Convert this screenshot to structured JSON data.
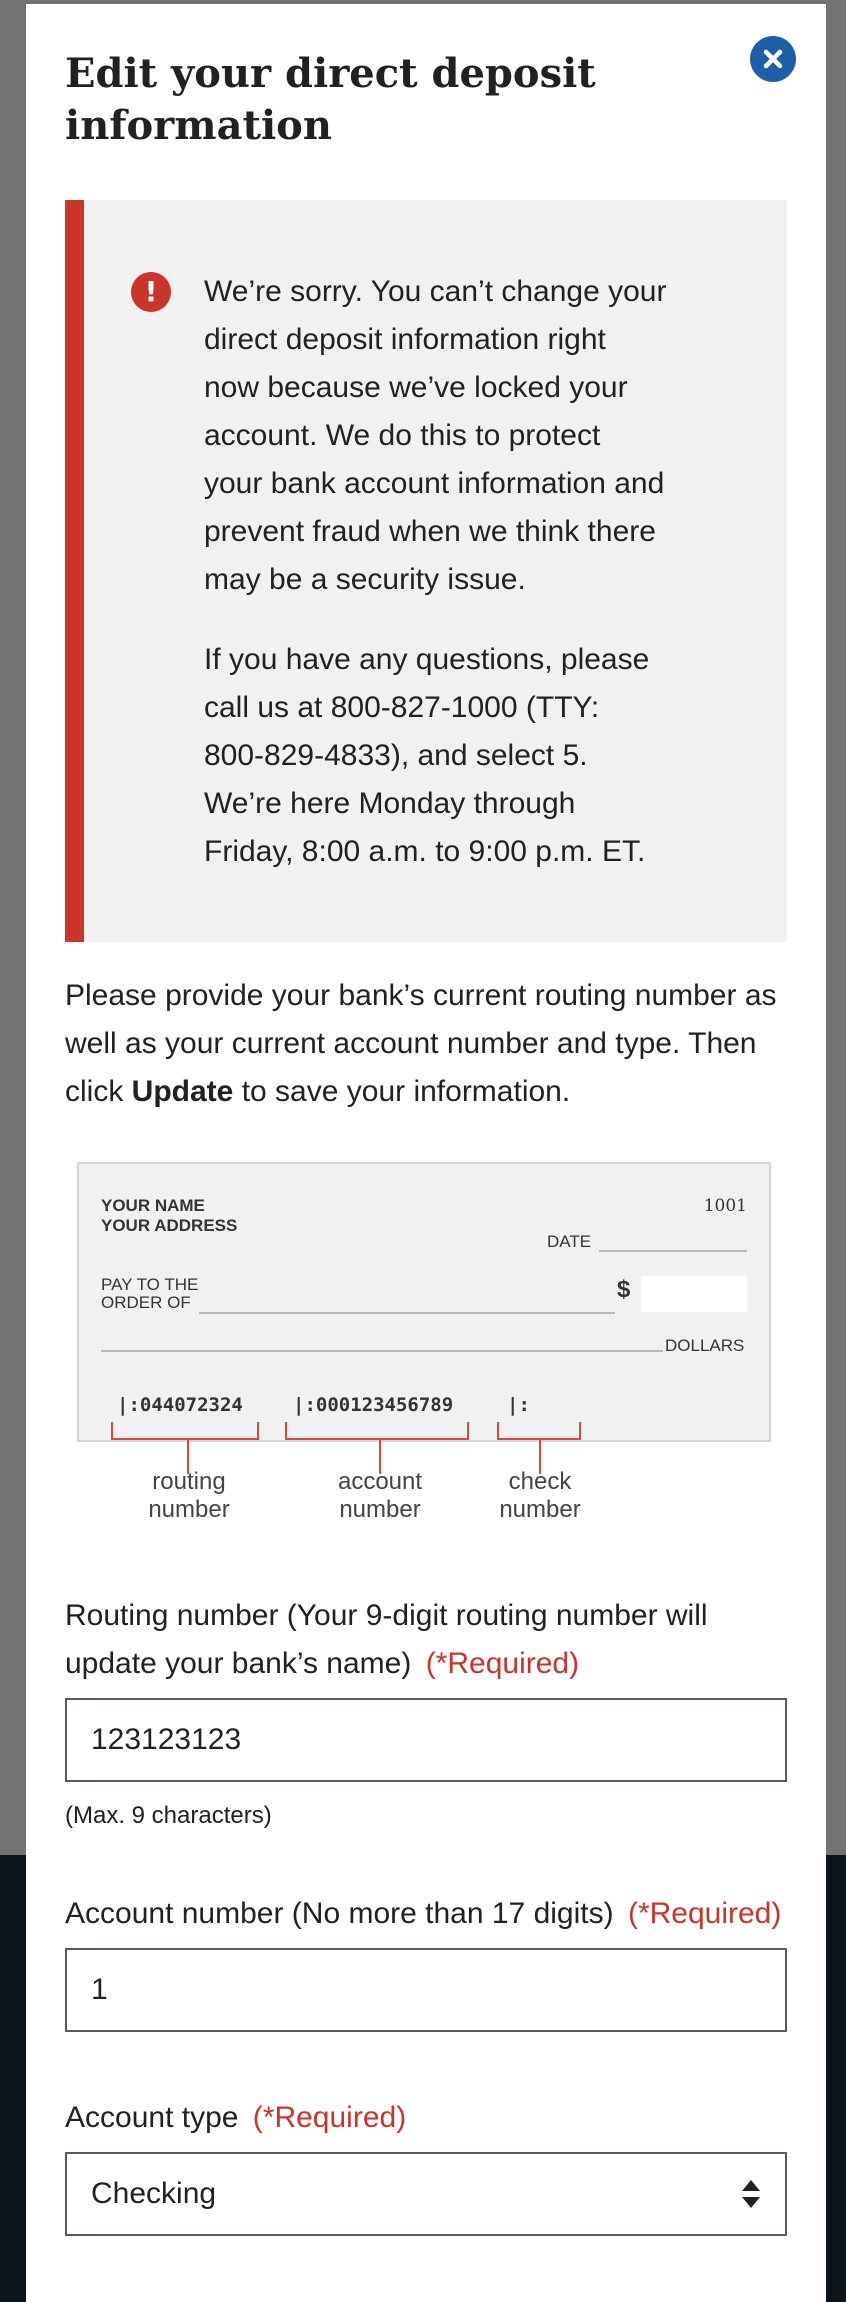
{
  "modal": {
    "title": "Edit your direct deposit information",
    "close_icon": "close-icon"
  },
  "alert": {
    "icon": "error-icon",
    "paragraph1": "We’re sorry. You can’t change your direct deposit information right now because we’ve locked your account. We do this to protect your bank account information and prevent fraud when we think there may be a security issue.",
    "paragraph2": "If you have any questions, please call us at 800-827-1000 (TTY: 800-829-4833), and select 5. We’re here Monday through Friday, 8:00 a.m. to 9:00 p.m. ET.",
    "accent_color": "#c9342b"
  },
  "intro": {
    "before": "Please provide your bank’s current routing number as well as your current account number and type. Then click ",
    "bold": "Update",
    "after": " to save your information."
  },
  "check": {
    "name": "YOUR NAME",
    "address": "YOUR ADDRESS",
    "number": "1001",
    "date_label": "DATE",
    "pay_to_line1": "PAY TO THE",
    "pay_to_line2": "ORDER OF",
    "dollar_sign": "$",
    "dollars_label": "DOLLARS",
    "routing_micr": "|:044072324",
    "account_micr": "|:000123456789",
    "check_micr": "|:",
    "caption_routing_1": "routing",
    "caption_routing_2": "number",
    "caption_account_1": "account",
    "caption_account_2": "number",
    "caption_check_1": "check",
    "caption_check_2": "number"
  },
  "form": {
    "routing": {
      "label": "Routing number (Your 9-digit routing number will update your bank’s name)",
      "required": "(*Required)",
      "value": "123123123",
      "hint": "(Max. 9 characters)"
    },
    "account": {
      "label": "Account number (No more than 17 digits)",
      "required": "(*Required)",
      "value": "1"
    },
    "account_type": {
      "label": "Account type",
      "required": "(*Required)",
      "selected": "Checking"
    }
  },
  "colors": {
    "primary": "#1f5ea8",
    "error": "#c9342b",
    "overlay": "#5b616b"
  }
}
